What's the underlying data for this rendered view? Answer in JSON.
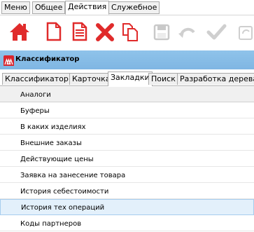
{
  "menu_tabs": [
    "Меню",
    "Общее",
    "Действия",
    "Служебное"
  ],
  "active_menu_tab": "Действия",
  "toolbar": {
    "icons": [
      "home-icon",
      "new-document-icon",
      "document-icon",
      "delete-icon",
      "copy-icon",
      "save-icon",
      "undo-icon",
      "check-icon",
      "refresh-icon"
    ]
  },
  "window": {
    "title": "Классификатор"
  },
  "tabs": [
    "Классификатор",
    "Карточка",
    "Закладки",
    "Поиск",
    "Разработка дерева"
  ],
  "active_tab": "Закладки",
  "list": {
    "items": [
      "Аналоги",
      "Буферы",
      "В каких изделиях",
      "Внешние заказы",
      "Действующие цены",
      "Заявка на занесение товара",
      "История себестоимости",
      "История тех операций",
      "Коды партнеров"
    ],
    "selected": "История тех операций"
  },
  "colors": {
    "accent_red": "#e02b2b",
    "title_bar": "#86bbe6",
    "selection": "#e3f0fb"
  }
}
